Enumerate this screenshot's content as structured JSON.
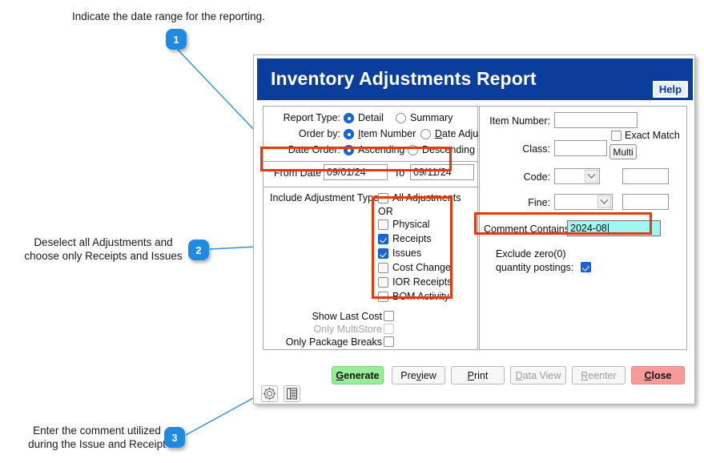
{
  "annotations": [
    {
      "id": 1,
      "number": "1",
      "text": "Indicate the date range for the reporting."
    },
    {
      "id": 2,
      "number": "2",
      "text": "Deselect all Adjustments and\nchoose only Receipts and Issues"
    },
    {
      "id": 3,
      "number": "3",
      "text": "Enter the comment utilized\nduring the Issue and Receipt"
    }
  ],
  "dialog": {
    "title": "Inventory Adjustments Report",
    "help_label": "Help",
    "titlebar_color": "#0b3e9c",
    "highlight_color": "#e8380d"
  },
  "left_panel": {
    "report_type": {
      "label": "Report Type:",
      "options": [
        {
          "label": "Detail",
          "selected": true
        },
        {
          "label": "Summary",
          "selected": false
        }
      ]
    },
    "order_by": {
      "label": "Order by:",
      "options": [
        {
          "label": "Item Number",
          "accel": "I",
          "selected": true
        },
        {
          "label": "Date Adjusted",
          "accel": "D",
          "selected": false
        }
      ]
    },
    "date_order": {
      "label": "Date Order:",
      "options": [
        {
          "label": "Ascending",
          "selected": true
        },
        {
          "label": "Descending",
          "selected": false
        }
      ]
    },
    "dates": {
      "from_label": "From Date",
      "from_value": "09/01/24",
      "to_label": "To",
      "to_value": "09/11/24"
    },
    "adjustment_types": {
      "label": "Include Adjustment Types:",
      "or_label": "OR",
      "items": [
        {
          "label": "All Adjustments",
          "checked": false
        },
        {
          "label": "Physical",
          "checked": false
        },
        {
          "label": "Receipts",
          "checked": true
        },
        {
          "label": "Issues",
          "checked": true
        },
        {
          "label": "Cost Change",
          "checked": false
        },
        {
          "label": "IOR Receipts",
          "checked": false
        },
        {
          "label": "BOM Activity",
          "checked": false
        }
      ]
    },
    "options": [
      {
        "label": "Show Last Cost",
        "checked": false,
        "disabled": false
      },
      {
        "label": "Only MultiStore",
        "checked": false,
        "disabled": true
      },
      {
        "label": "Only Package Breaks",
        "checked": false,
        "disabled": false
      }
    ]
  },
  "right_panel": {
    "item_number": {
      "label": "Item Number:",
      "value": ""
    },
    "class": {
      "label": "Class:",
      "value": ""
    },
    "exact_match": {
      "label": "Exact Match",
      "checked": false
    },
    "multi_button": "Multi",
    "code": {
      "label": "Code:",
      "value": "",
      "extra_value": ""
    },
    "fine": {
      "label": "Fine:",
      "value": "",
      "extra_value": ""
    },
    "comment_contains": {
      "label": "Comment Contains:",
      "value": "2024-08"
    },
    "exclude_zero": {
      "label_line1": "Exclude zero(0)",
      "label_line2": "quantity postings:",
      "checked": true
    }
  },
  "buttons": [
    {
      "label": "Generate",
      "accel": "G",
      "style": "green",
      "disabled": false
    },
    {
      "label": "Preview",
      "accel": "v",
      "style": "normal",
      "disabled": false
    },
    {
      "label": "Print",
      "accel": "P",
      "style": "normal",
      "disabled": false
    },
    {
      "label": "Data View",
      "accel": "D",
      "style": "normal",
      "disabled": true
    },
    {
      "label": "Reenter",
      "accel": "R",
      "style": "normal",
      "disabled": true
    },
    {
      "label": "Close",
      "accel": "C",
      "style": "red",
      "disabled": false
    }
  ],
  "icon_buttons": [
    {
      "name": "gear-icon"
    },
    {
      "name": "list-view-icon"
    }
  ]
}
